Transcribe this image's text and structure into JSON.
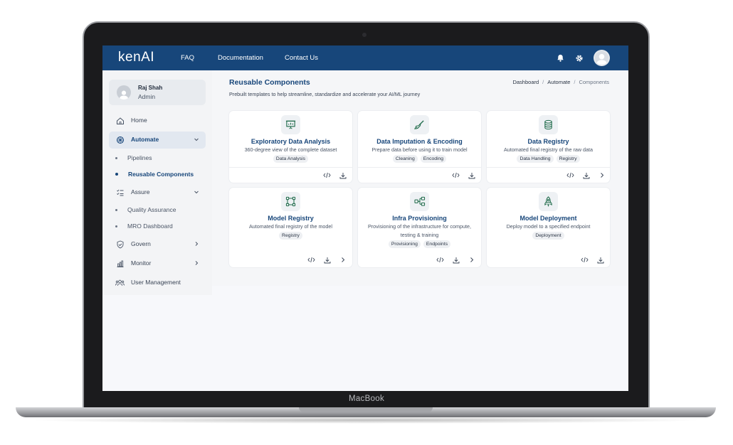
{
  "device": {
    "brand": "MacBook"
  },
  "app": {
    "logo": "kenAI"
  },
  "topbar": {
    "nav": [
      "FAQ",
      "Documentation",
      "Contact Us"
    ],
    "icons": [
      "bell-icon",
      "gear-icon",
      "avatar"
    ]
  },
  "user": {
    "name": "Raj Shah",
    "role": "Admin"
  },
  "sidebar": {
    "home": "Home",
    "automate": "Automate",
    "pipelines": "Pipelines",
    "reusable": "Reusable Components",
    "assure": "Assure",
    "quality": "Quality Assurance",
    "mro": "MRO Dashboard",
    "govern": "Govern",
    "monitor": "Monitor",
    "users": "User Management"
  },
  "page": {
    "title": "Reusable Components",
    "subtitle": "Prebuilt templates to help streamline, standardize and accelerate your AI/ML journey",
    "breadcrumb": [
      "Dashboard",
      "Automate",
      "Components"
    ]
  },
  "cards": [
    {
      "title": "Exploratory Data Analysis",
      "desc": "360-degree view of the complete dataset",
      "tags": [
        "Data Analysis"
      ],
      "icon": "presentation-chart-icon"
    },
    {
      "title": "Data Imputation & Encoding",
      "desc": "Prepare data before using it to train model",
      "tags": [
        "Cleaning",
        "Encoding"
      ],
      "icon": "brush-icon"
    },
    {
      "title": "Data Registry",
      "desc": "Automated final registry of the raw data",
      "tags": [
        "Data Handling",
        "Registry"
      ],
      "icon": "database-icon"
    },
    {
      "title": "Model Registry",
      "desc": "Automated final registry of the model",
      "tags": [
        "Registry"
      ],
      "icon": "network-nodes-icon"
    },
    {
      "title": "Infra Provisioning",
      "desc": "Provisioning of the infrastructure for compute, testing & training",
      "tags": [
        "Provisioning",
        "Endpoints"
      ],
      "icon": "hierarchy-icon"
    },
    {
      "title": "Model Deployment",
      "desc": "Deploy model to a specified endpoint",
      "tags": [
        "Deployment"
      ],
      "icon": "rocket-icon"
    }
  ],
  "colors": {
    "primary": "#17467a",
    "accent": "#1f6b4a"
  }
}
